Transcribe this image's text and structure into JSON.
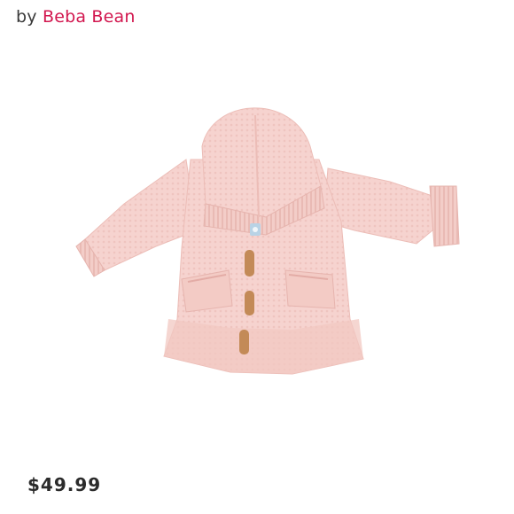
{
  "brand": {
    "prefix": "by",
    "name": "Beba Bean",
    "prefix_color": "#3a3a3a",
    "name_color": "#d2174f"
  },
  "product": {
    "image_icon": "pink-knit-hooded-cardigan-image",
    "image_colors": {
      "knit": "#f6d3cf",
      "knit_shadow": "#ecbdb7",
      "toggle_button": "#c38a57",
      "label": "#b9d3e6"
    },
    "price": "$49.99"
  }
}
